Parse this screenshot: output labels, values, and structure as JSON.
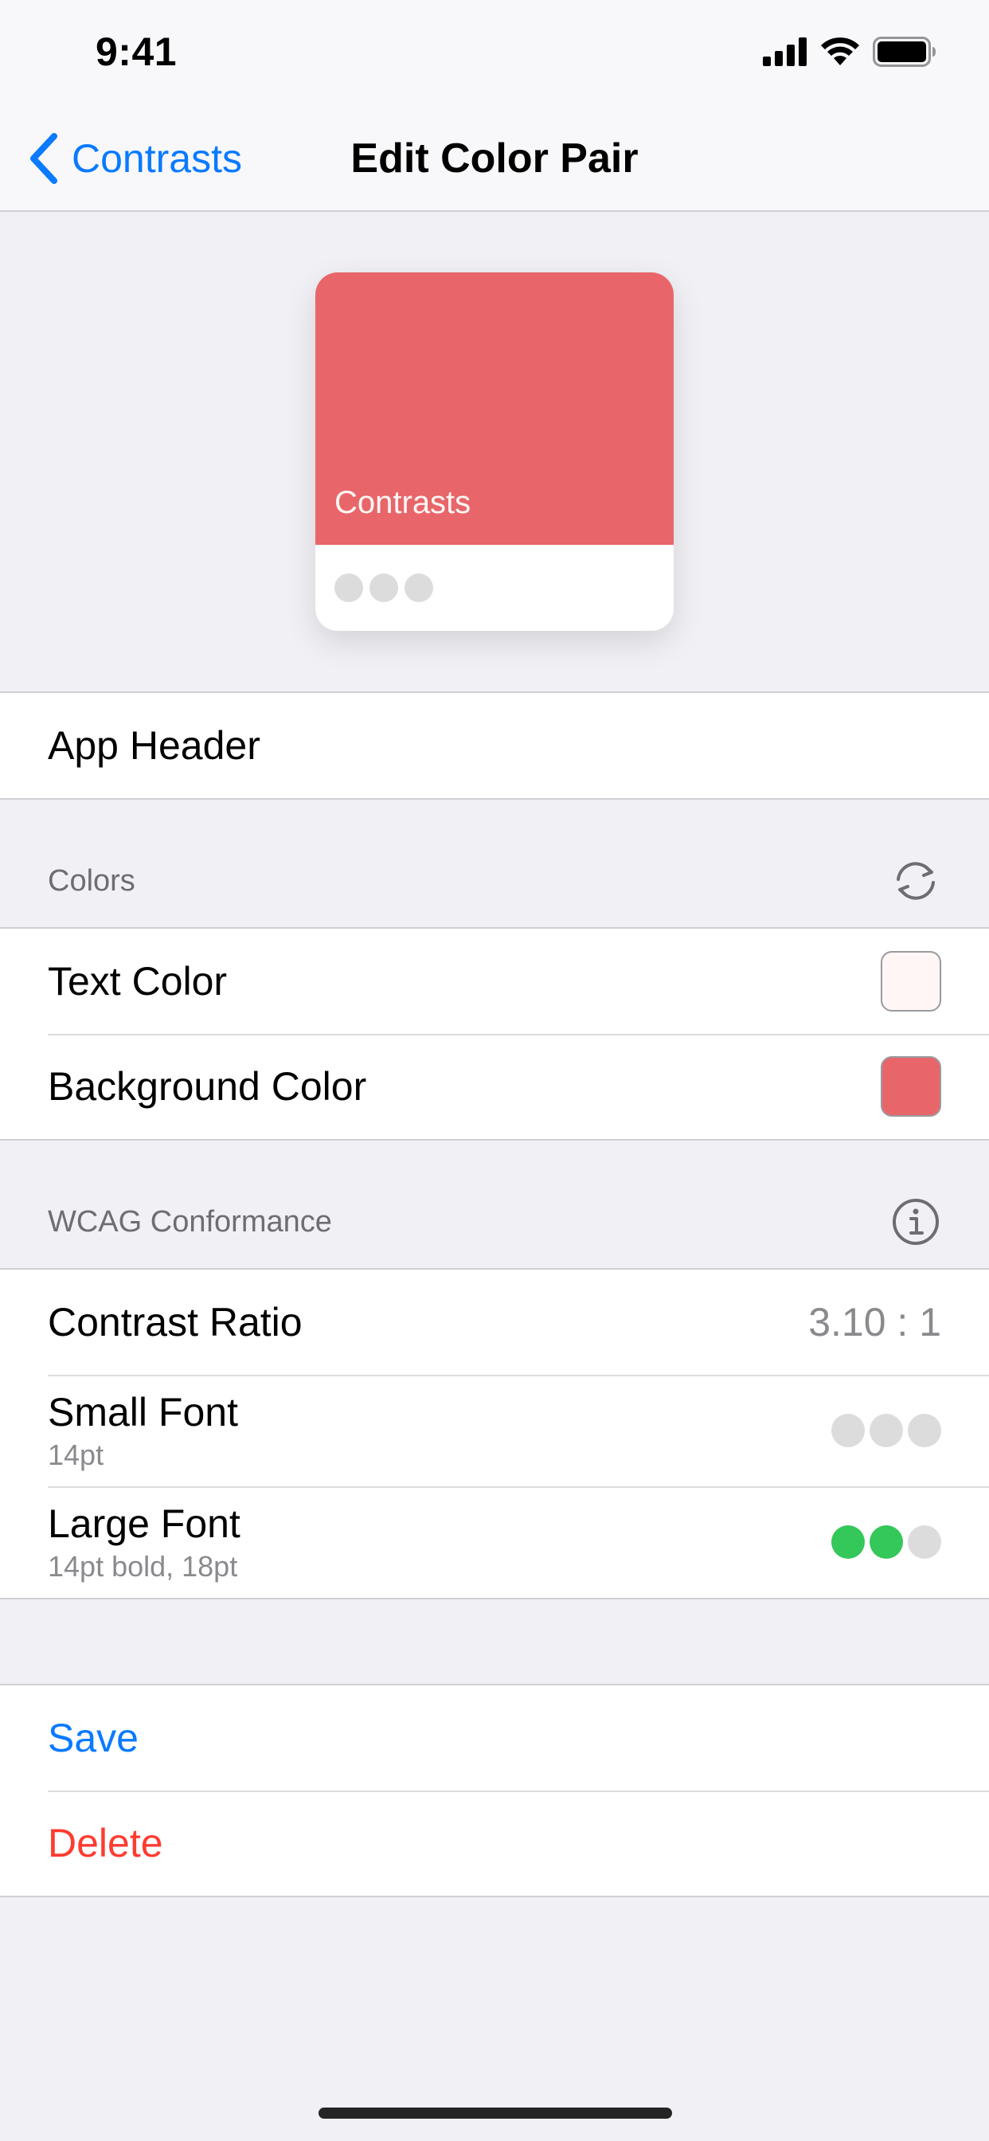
{
  "status_bar": {
    "time": "9:41"
  },
  "nav": {
    "back_label": "Contrasts",
    "title": "Edit Color Pair"
  },
  "preview": {
    "title": "Contrasts",
    "background_color": "#e8666a",
    "text_color": "#fff6f5"
  },
  "name_row": {
    "label": "App Header"
  },
  "colors_section": {
    "header": "Colors",
    "text_color_label": "Text Color",
    "text_color_value": "#fff6f5",
    "background_color_label": "Background Color",
    "background_color_value": "#e8666a"
  },
  "wcag_section": {
    "header": "WCAG Conformance",
    "contrast_ratio_label": "Contrast Ratio",
    "contrast_ratio_value": "3.10 : 1",
    "small_font_label": "Small Font",
    "small_font_sub": "14pt",
    "small_font_passed": 0,
    "large_font_label": "Large Font",
    "large_font_sub": "14pt bold, 18pt",
    "large_font_passed": 2,
    "level_count": 3,
    "pass_color": "#34c759",
    "fail_color": "#dcdcdc"
  },
  "actions": {
    "save_label": "Save",
    "delete_label": "Delete",
    "save_color": "#0a7aff",
    "delete_color": "#ff3b30"
  }
}
